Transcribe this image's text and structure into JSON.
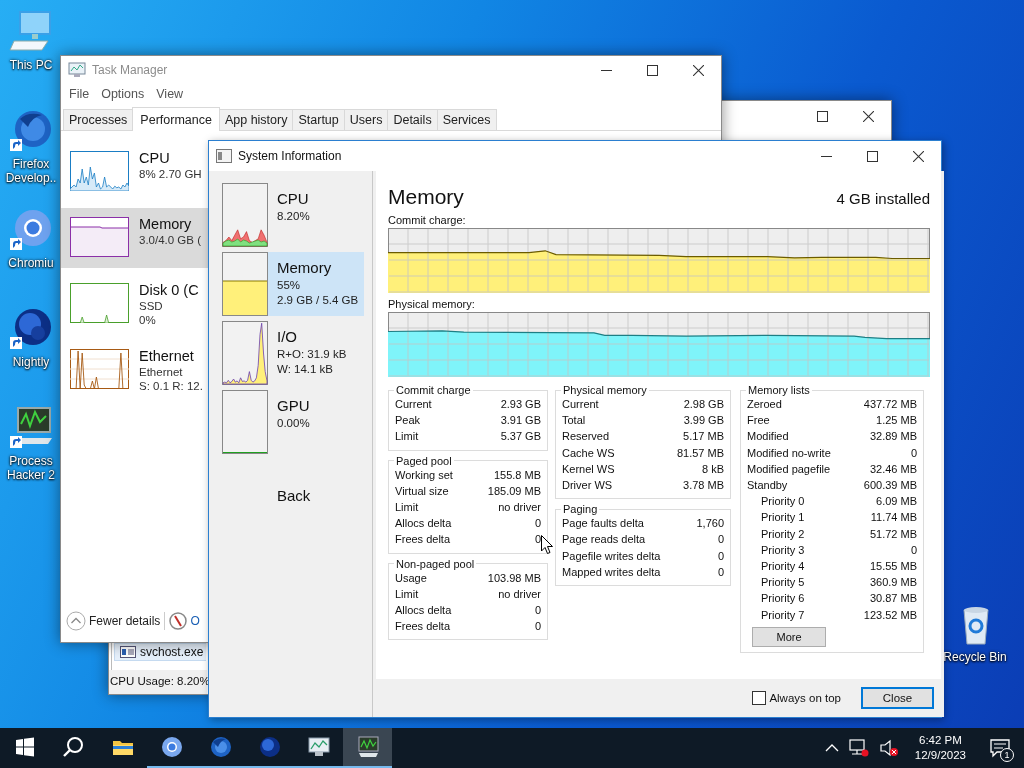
{
  "desktop_icons": [
    {
      "label": "This PC",
      "kind": "computer"
    },
    {
      "label": "Firefox Develop..",
      "kind": "firefox"
    },
    {
      "label": "Chromiu",
      "kind": "chromium"
    },
    {
      "label": "Nightly",
      "kind": "nightly"
    },
    {
      "label": "Process Hacker 2",
      "kind": "hacker"
    }
  ],
  "recycle_bin": {
    "label": "Recycle Bin"
  },
  "background_window": {
    "list_row": "svchost.exe",
    "status": "CPU Usage: 8.20%"
  },
  "task_manager": {
    "title": "Task Manager",
    "menu": [
      "File",
      "Options",
      "View"
    ],
    "tabs": [
      {
        "label": "Processes",
        "selected": false
      },
      {
        "label": "Performance",
        "selected": true
      },
      {
        "label": "App history",
        "selected": false
      },
      {
        "label": "Startup",
        "selected": false
      },
      {
        "label": "Users",
        "selected": false
      },
      {
        "label": "Details",
        "selected": false
      },
      {
        "label": "Services",
        "selected": false
      }
    ],
    "resources": [
      {
        "kind": "cpu",
        "name": "CPU",
        "lines": [
          "8% 2.70 GH"
        ],
        "selected": false
      },
      {
        "kind": "memory",
        "name": "Memory",
        "lines": [
          "3.0/4.0 GB ("
        ],
        "selected": true
      },
      {
        "kind": "disk",
        "name": "Disk 0 (C",
        "lines": [
          "SSD",
          "0%"
        ],
        "selected": false
      },
      {
        "kind": "ethernet",
        "name": "Ethernet",
        "lines": [
          "Ethernet",
          "S: 0.1 R: 12."
        ],
        "selected": false
      }
    ],
    "footer": {
      "fewer_details": "Fewer details",
      "link": "O"
    }
  },
  "system_information": {
    "title": "System Information",
    "sidebar": [
      {
        "kind": "cpu",
        "name": "CPU",
        "lines": [
          "8.20%"
        ],
        "selected": false
      },
      {
        "kind": "memory",
        "name": "Memory",
        "lines": [
          "55%",
          "2.9 GB / 5.4 GB"
        ],
        "selected": true
      },
      {
        "kind": "io",
        "name": "I/O",
        "lines": [
          "R+O: 31.9 kB",
          "W: 14.1 kB"
        ],
        "selected": false
      },
      {
        "kind": "gpu",
        "name": "GPU",
        "lines": [
          "0.00%"
        ],
        "selected": false
      }
    ],
    "back": "Back",
    "heading": "Memory",
    "installed": "4 GB installed",
    "graphs": [
      {
        "label": "Commit charge:",
        "kind": "commit"
      },
      {
        "label": "Physical memory:",
        "kind": "physical"
      }
    ],
    "columns": [
      [
        {
          "title": "Commit charge",
          "rows": [
            {
              "label": "Current",
              "value": "2.93 GB"
            },
            {
              "label": "Peak",
              "value": "3.91 GB"
            },
            {
              "label": "Limit",
              "value": "5.37 GB"
            }
          ]
        },
        {
          "title": "Paged pool",
          "rows": [
            {
              "label": "Working set",
              "value": "155.8 MB"
            },
            {
              "label": "Virtual size",
              "value": "185.09 MB"
            },
            {
              "label": "Limit",
              "value": "no driver"
            },
            {
              "label": "Allocs delta",
              "value": "0"
            },
            {
              "label": "Frees delta",
              "value": "0"
            }
          ]
        },
        {
          "title": "Non-paged pool",
          "rows": [
            {
              "label": "Usage",
              "value": "103.98 MB"
            },
            {
              "label": "Limit",
              "value": "no driver"
            },
            {
              "label": "Allocs delta",
              "value": "0"
            },
            {
              "label": "Frees delta",
              "value": "0"
            }
          ]
        }
      ],
      [
        {
          "title": "Physical memory",
          "rows": [
            {
              "label": "Current",
              "value": "2.98 GB"
            },
            {
              "label": "Total",
              "value": "3.99 GB"
            },
            {
              "label": "Reserved",
              "value": "5.17 MB"
            },
            {
              "label": "Cache WS",
              "value": "81.57 MB"
            },
            {
              "label": "Kernel WS",
              "value": "8 kB"
            },
            {
              "label": "Driver WS",
              "value": "3.78 MB"
            }
          ]
        },
        {
          "title": "Paging",
          "rows": [
            {
              "label": "Page faults delta",
              "value": "1,760"
            },
            {
              "label": "Page reads delta",
              "value": "0"
            },
            {
              "label": "Pagefile writes delta",
              "value": "0"
            },
            {
              "label": "Mapped writes delta",
              "value": "0"
            }
          ]
        }
      ],
      [
        {
          "title": "Memory lists",
          "rows": [
            {
              "label": "Zeroed",
              "value": "437.72 MB"
            },
            {
              "label": "Free",
              "value": "1.25 MB"
            },
            {
              "label": "Modified",
              "value": "32.89 MB"
            },
            {
              "label": "Modified no-write",
              "value": "0"
            },
            {
              "label": "Modified pagefile",
              "value": "32.46 MB"
            },
            {
              "label": "Standby",
              "value": "600.39 MB",
              "children": [
                {
                  "label": "Priority 0",
                  "value": "6.09 MB"
                },
                {
                  "label": "Priority 1",
                  "value": "11.74 MB"
                },
                {
                  "label": "Priority 2",
                  "value": "51.72 MB"
                },
                {
                  "label": "Priority 3",
                  "value": "0"
                },
                {
                  "label": "Priority 4",
                  "value": "15.55 MB"
                },
                {
                  "label": "Priority 5",
                  "value": "360.9 MB"
                },
                {
                  "label": "Priority 6",
                  "value": "30.87 MB"
                },
                {
                  "label": "Priority 7",
                  "value": "123.52 MB"
                }
              ]
            }
          ],
          "button": "More"
        }
      ]
    ],
    "always_on_top": {
      "label": "Always on top",
      "checked": false
    },
    "close": "Close"
  },
  "taskbar": {
    "apps": [
      {
        "kind": "start",
        "running": false,
        "active": false
      },
      {
        "kind": "search",
        "running": false,
        "active": false
      },
      {
        "kind": "explorer",
        "running": false,
        "active": false
      },
      {
        "kind": "chromium",
        "running": true,
        "active": false
      },
      {
        "kind": "firefox",
        "running": true,
        "active": false
      },
      {
        "kind": "nightly",
        "running": true,
        "active": false
      },
      {
        "kind": "taskmanager",
        "running": true,
        "active": false
      },
      {
        "kind": "hacker",
        "running": true,
        "active": true
      }
    ],
    "time": "6:42 PM",
    "date": "12/9/2023",
    "notifications": "1"
  }
}
